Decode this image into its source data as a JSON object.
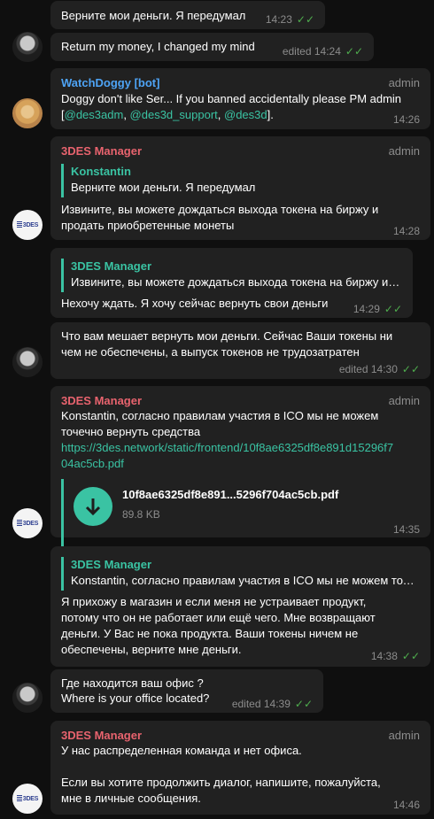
{
  "tick": "✓✓",
  "messages": {
    "m1": {
      "text": "Верните мои деньги. Я передумал",
      "time": "14:23"
    },
    "m2": {
      "text": "Return my money, I changed my mind",
      "time": "edited 14:24"
    },
    "m3": {
      "sender": "WatchDoggy [bot]",
      "role": "admin",
      "line1": "Doggy don't like Ser... If you banned accidentally please PM admin",
      "line2_pre": "[",
      "h1": "@des3adm",
      "sep1": ", ",
      "h2": "@des3d_support",
      "sep2": ", ",
      "h3": "@des3d",
      "line2_post": "].",
      "time": "14:26"
    },
    "m4": {
      "sender": "3DES Manager",
      "role": "admin",
      "reply_name": "Konstantin",
      "reply_text": "Верните мои деньги. Я передумал",
      "line1": "Извините, вы можете дождаться выхода токена на биржу и",
      "line2": "продать приобретенные монеты",
      "time": "14:28"
    },
    "m5": {
      "reply_name": "3DES Manager",
      "reply_text": "Извините, вы можете дождаться выхода токена на биржу и продать приобретенные монеты",
      "text": "Нехочу ждать. Я хочу сейчас вернуть свои деньги",
      "time": "14:29"
    },
    "m6": {
      "line1": "Что вам мешает вернуть мои деньги. Сейчас Ваши токены ни",
      "line2": "чем не обеспечены, а выпуск токенов не трудозатратен",
      "time": "edited 14:30"
    },
    "m7": {
      "sender": "3DES Manager",
      "role": "admin",
      "line1": "Konstantin, согласно правилам участия в ICO мы не можем",
      "line2": "точечно вернуть средства",
      "link1": "https://3des.network/static/frontend/10f8ae6325df8e891d15296f7",
      "link2": "04ac5cb.pdf",
      "file_name": "10f8ae6325df8e891...5296f704ac5cb.pdf",
      "file_size": "89.8 KB",
      "time": "14:35"
    },
    "m8": {
      "reply_name": "3DES Manager",
      "reply_text": "Konstantin, согласно правилам участия в ICO мы не можем точечно вернуть средства",
      "line1": "Я прихожу в магазин и если меня не устраивает продукт,",
      "line2": "потому что он не работает или ещё чего. Мне возвращают",
      "line3": "деньги. У Вас не пока продукта. Ваши токены ничем не",
      "line4": "обеспечены, верните мне деньги.",
      "time": "14:38"
    },
    "m9": {
      "line1": "Где находится ваш офис ?",
      "line2": "Where is your office located?",
      "time": "edited 14:39"
    },
    "m10": {
      "sender": "3DES Manager",
      "role": "admin",
      "line1": "У нас распределенная команда и нет офиса.",
      "line2": "Если вы хотите продолжить диалог, напишите, пожалуйста,",
      "line3": "мне в личные сообщения.",
      "time": "14:46"
    }
  },
  "avatars": {
    "manager_logo_text": "3DES"
  }
}
